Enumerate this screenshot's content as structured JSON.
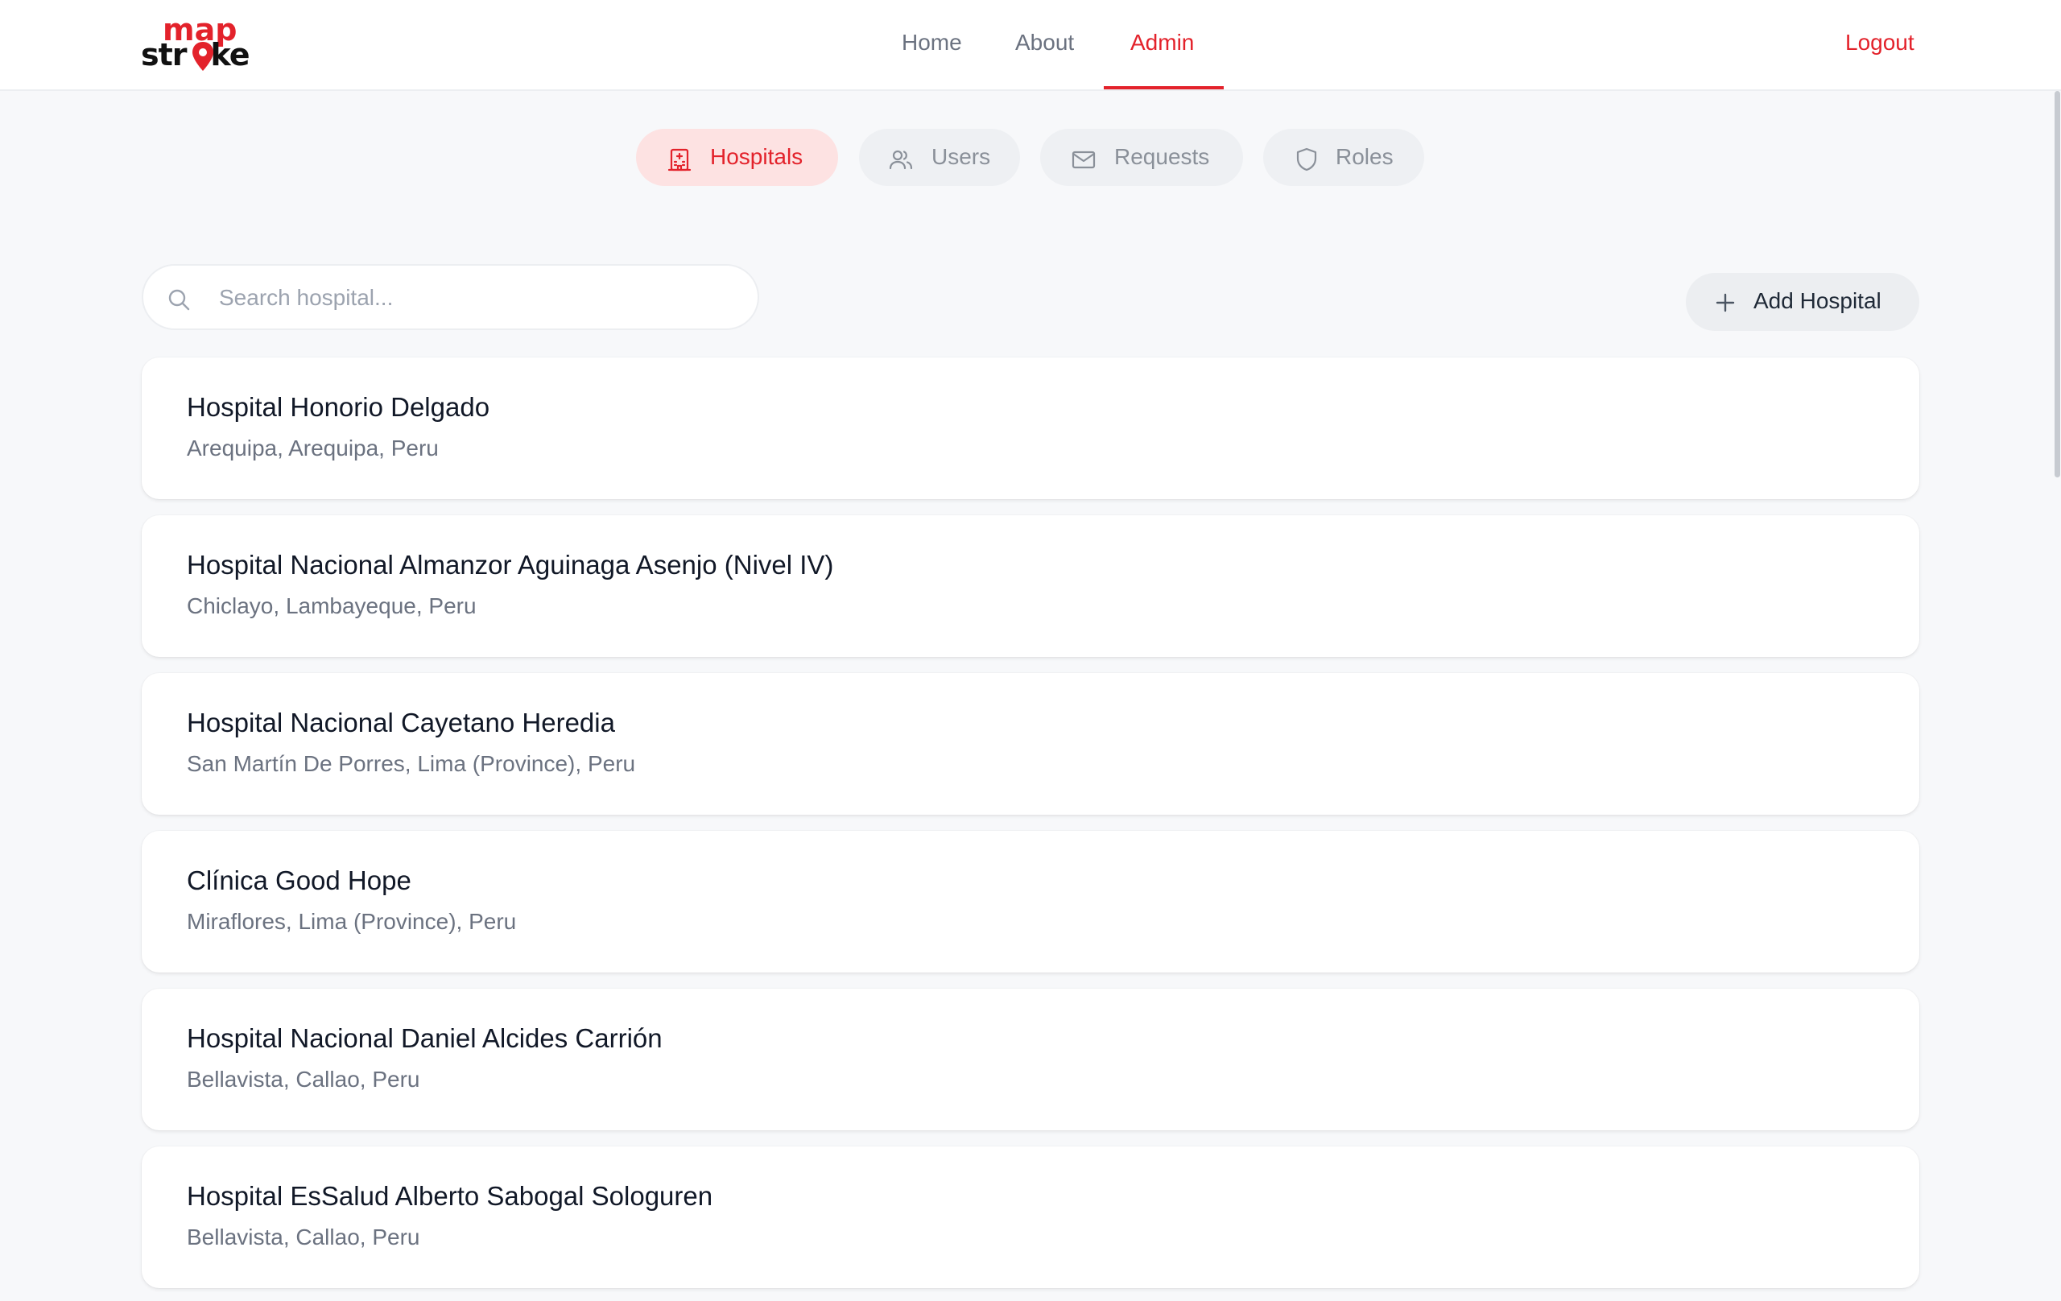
{
  "header": {
    "logo": {
      "line1": "map",
      "line2_left": "str",
      "line2_right": "ke"
    },
    "nav": [
      {
        "label": "Home"
      },
      {
        "label": "About"
      },
      {
        "label": "Admin"
      }
    ],
    "active_nav": "Admin",
    "logout_label": "Logout"
  },
  "tabs": [
    {
      "label": "Hospitals",
      "icon": "hospital-icon",
      "active": true
    },
    {
      "label": "Users",
      "icon": "users-icon",
      "active": false
    },
    {
      "label": "Requests",
      "icon": "mail-icon",
      "active": false
    },
    {
      "label": "Roles",
      "icon": "shield-icon",
      "active": false
    }
  ],
  "search": {
    "placeholder": "Search hospital...",
    "value": ""
  },
  "add_button": {
    "label": "Add Hospital",
    "icon": "plus-icon"
  },
  "hospitals": [
    {
      "name": "Hospital Honorio Delgado",
      "location": "Arequipa, Arequipa, Peru"
    },
    {
      "name": "Hospital Nacional Almanzor Aguinaga Asenjo (Nivel IV)",
      "location": "Chiclayo, Lambayeque, Peru"
    },
    {
      "name": "Hospital Nacional Cayetano Heredia",
      "location": "San Martín De Porres, Lima (Province), Peru"
    },
    {
      "name": "Clínica Good Hope",
      "location": "Miraflores, Lima (Province), Peru"
    },
    {
      "name": "Hospital Nacional Daniel Alcides Carrión",
      "location": "Bellavista, Callao, Peru"
    },
    {
      "name": "Hospital EsSalud Alberto Sabogal Sologuren",
      "location": "Bellavista, Callao, Peru"
    }
  ],
  "colors": {
    "accent": "#e3222b",
    "accent_soft": "#fde2e2",
    "background": "#f7f8fa",
    "muted_text": "#6b7280"
  }
}
